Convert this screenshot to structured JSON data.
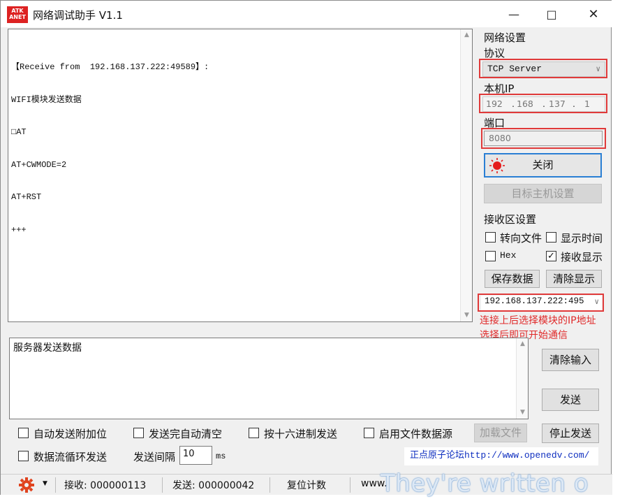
{
  "window": {
    "logo_text": "ATK\nANET",
    "title": "网络调试助手 V1.1"
  },
  "receive": {
    "lines": [
      "【Receive from  192.168.137.222:49589】:",
      "WIFI模块发送数据",
      "□AT",
      "AT+CWMODE=2",
      "AT+RST",
      "+++"
    ]
  },
  "network": {
    "group_title": "网络设置",
    "protocol_label": "协议",
    "protocol_value": "TCP Server",
    "local_ip_label": "本机IP",
    "ip_octets": [
      "192",
      "168",
      "137",
      "1"
    ],
    "port_label": "端口",
    "port_value": "8080",
    "close_button": "关闭",
    "target_host_button": "目标主机设置"
  },
  "receive_settings": {
    "group_title": "接收区设置",
    "redirect_file": "转向文件",
    "show_time": "显示时间",
    "hex": "Hex",
    "receive_display": "接收显示",
    "receive_display_checked": true,
    "save_data": "保存数据",
    "clear_display": "清除显示"
  },
  "client_select": "192.168.137.222:495",
  "hint": [
    "连接上后选择模块的IP地址",
    "选择后即可开始通信"
  ],
  "send": {
    "text": "服务器发送数据",
    "clear_input": "清除输入",
    "send_button": "发送",
    "auto_append": "自动发送附加位",
    "auto_clear": "发送完自动清空",
    "hex_send": "按十六进制发送",
    "file_source": "启用文件数据源",
    "load_file": "加载文件",
    "stop_send": "停止发送",
    "loop_send": "数据流循环发送",
    "interval_label": "发送间隔",
    "interval_value": "10",
    "interval_unit": "ms"
  },
  "forum_link": "正点原子论坛http://www.openedv.com/",
  "status": {
    "receive": "接收: 000000113",
    "send": "发送: 000000042",
    "reset": "复位计数",
    "url_partial": "www."
  },
  "watermark": "They're written o",
  "colors": {
    "highlight_border": "#e03a3a",
    "accent_blue": "#2a7fd4",
    "hint_red": "#e02a2a"
  }
}
